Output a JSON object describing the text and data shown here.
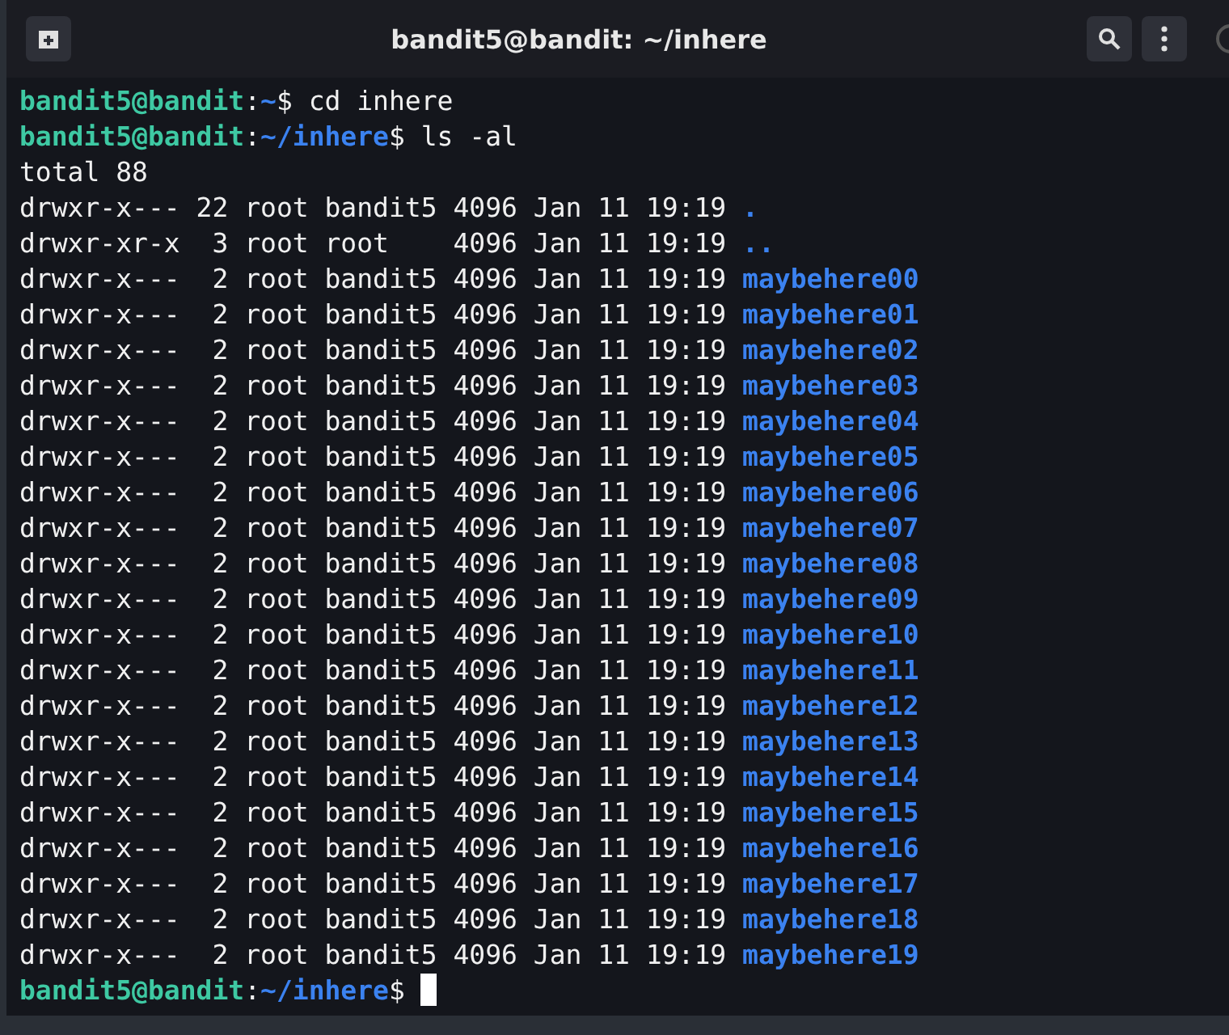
{
  "window": {
    "title": "bandit5@bandit: ~/inhere"
  },
  "terminal": {
    "lines": [
      {
        "kind": "prompt",
        "segments": [
          {
            "kind": "host",
            "text": "bandit5@bandit"
          },
          {
            "kind": "plain",
            "text": ":"
          },
          {
            "kind": "path",
            "text": "~"
          },
          {
            "kind": "plain",
            "text": "$ cd inhere"
          }
        ],
        "cursor": false
      },
      {
        "kind": "prompt",
        "segments": [
          {
            "kind": "host",
            "text": "bandit5@bandit"
          },
          {
            "kind": "plain",
            "text": ":"
          },
          {
            "kind": "path",
            "text": "~/inhere"
          },
          {
            "kind": "plain",
            "text": "$ ls -al"
          }
        ],
        "cursor": false
      },
      {
        "kind": "output",
        "text": "total 88"
      },
      {
        "kind": "entry",
        "info": "drwxr-x--- 22 root bandit5 4096 Jan 11 19:19",
        "name": "."
      },
      {
        "kind": "entry",
        "info": "drwxr-xr-x  3 root root    4096 Jan 11 19:19",
        "name": ".."
      },
      {
        "kind": "entry",
        "info": "drwxr-x---  2 root bandit5 4096 Jan 11 19:19",
        "name": "maybehere00"
      },
      {
        "kind": "entry",
        "info": "drwxr-x---  2 root bandit5 4096 Jan 11 19:19",
        "name": "maybehere01"
      },
      {
        "kind": "entry",
        "info": "drwxr-x---  2 root bandit5 4096 Jan 11 19:19",
        "name": "maybehere02"
      },
      {
        "kind": "entry",
        "info": "drwxr-x---  2 root bandit5 4096 Jan 11 19:19",
        "name": "maybehere03"
      },
      {
        "kind": "entry",
        "info": "drwxr-x---  2 root bandit5 4096 Jan 11 19:19",
        "name": "maybehere04"
      },
      {
        "kind": "entry",
        "info": "drwxr-x---  2 root bandit5 4096 Jan 11 19:19",
        "name": "maybehere05"
      },
      {
        "kind": "entry",
        "info": "drwxr-x---  2 root bandit5 4096 Jan 11 19:19",
        "name": "maybehere06"
      },
      {
        "kind": "entry",
        "info": "drwxr-x---  2 root bandit5 4096 Jan 11 19:19",
        "name": "maybehere07"
      },
      {
        "kind": "entry",
        "info": "drwxr-x---  2 root bandit5 4096 Jan 11 19:19",
        "name": "maybehere08"
      },
      {
        "kind": "entry",
        "info": "drwxr-x---  2 root bandit5 4096 Jan 11 19:19",
        "name": "maybehere09"
      },
      {
        "kind": "entry",
        "info": "drwxr-x---  2 root bandit5 4096 Jan 11 19:19",
        "name": "maybehere10"
      },
      {
        "kind": "entry",
        "info": "drwxr-x---  2 root bandit5 4096 Jan 11 19:19",
        "name": "maybehere11"
      },
      {
        "kind": "entry",
        "info": "drwxr-x---  2 root bandit5 4096 Jan 11 19:19",
        "name": "maybehere12"
      },
      {
        "kind": "entry",
        "info": "drwxr-x---  2 root bandit5 4096 Jan 11 19:19",
        "name": "maybehere13"
      },
      {
        "kind": "entry",
        "info": "drwxr-x---  2 root bandit5 4096 Jan 11 19:19",
        "name": "maybehere14"
      },
      {
        "kind": "entry",
        "info": "drwxr-x---  2 root bandit5 4096 Jan 11 19:19",
        "name": "maybehere15"
      },
      {
        "kind": "entry",
        "info": "drwxr-x---  2 root bandit5 4096 Jan 11 19:19",
        "name": "maybehere16"
      },
      {
        "kind": "entry",
        "info": "drwxr-x---  2 root bandit5 4096 Jan 11 19:19",
        "name": "maybehere17"
      },
      {
        "kind": "entry",
        "info": "drwxr-x---  2 root bandit5 4096 Jan 11 19:19",
        "name": "maybehere18"
      },
      {
        "kind": "entry",
        "info": "drwxr-x---  2 root bandit5 4096 Jan 11 19:19",
        "name": "maybehere19"
      },
      {
        "kind": "prompt",
        "segments": [
          {
            "kind": "host",
            "text": "bandit5@bandit"
          },
          {
            "kind": "plain",
            "text": ":"
          },
          {
            "kind": "path",
            "text": "~/inhere"
          },
          {
            "kind": "plain",
            "text": "$ "
          }
        ],
        "cursor": true
      }
    ]
  }
}
